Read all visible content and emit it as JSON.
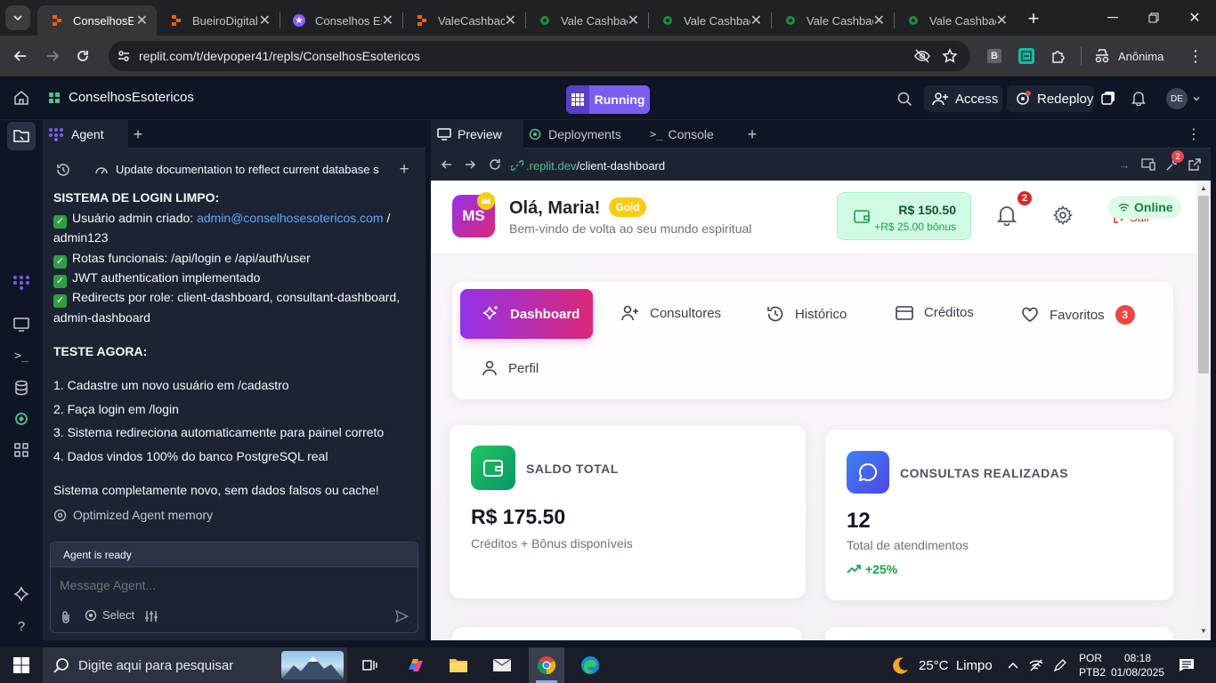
{
  "browser": {
    "tabs": [
      {
        "title": "ConselhosEs",
        "active": true,
        "icon": "replit-orange-icon"
      },
      {
        "title": "BueiroDigital",
        "active": false,
        "icon": "replit-orange-icon"
      },
      {
        "title": "Conselhos Es",
        "active": false,
        "icon": "purple-star-icon"
      },
      {
        "title": "ValeCashbac",
        "active": false,
        "icon": "replit-orange-icon"
      },
      {
        "title": "Vale Cashbac",
        "active": false,
        "icon": "green-globe-icon"
      },
      {
        "title": "Vale Cashbac",
        "active": false,
        "icon": "green-globe-icon"
      },
      {
        "title": "Vale Cashbac",
        "active": false,
        "icon": "green-globe-icon"
      },
      {
        "title": "Vale Cashbac",
        "active": false,
        "icon": "green-globe-icon"
      }
    ],
    "url": "replit.com/t/devpoper41/repls/ConselhosEsotericos",
    "profile_label": "Anônima",
    "ext_b_label": "B"
  },
  "replit": {
    "project_name": "ConselhosEsotericos",
    "run_status": "Running",
    "access_label": "Access",
    "redeploy_label": "Redeploy",
    "avatar_initials": "DE"
  },
  "agent": {
    "tab_label": "Agent",
    "task_title": "Update documentation to reflect current database s...",
    "messages": {
      "heading_system": "SISTEMA DE LOGIN LIMPO:",
      "admin_prefix": "Usuário admin criado: ",
      "admin_email": "admin@conselhosesotericos.com",
      "admin_suffix": " /",
      "admin_pass": "admin123",
      "routes": "Rotas funcionais: /api/login e /api/auth/user",
      "jwt": "JWT authentication implementado",
      "redirects_1": "Redirects por role: client-dashboard, consultant-dashboard,",
      "redirects_2": "admin-dashboard",
      "heading_test": "TESTE AGORA:",
      "step1": "1. Cadastre um novo usuário em /cadastro",
      "step2": "2. Faça login em /login",
      "step3": "3. Sistema redireciona automaticamente para painel correto",
      "step4": "4. Dados vindos 100% do banco PostgreSQL real",
      "summary": "Sistema completamente novo, sem dados falsos ou cache!",
      "memory": "Optimized Agent memory"
    },
    "status": "Agent is ready",
    "input_placeholder": "Message Agent...",
    "select_label": "Select"
  },
  "preview": {
    "tabs": {
      "preview": "Preview",
      "deployments": "Deployments",
      "console": "Console"
    },
    "url_domain": ".replit.dev",
    "url_path": "/client-dashboard",
    "extension_badge": "2"
  },
  "webapp": {
    "avatar_initials": "MS",
    "greeting": "Olá, Maria!",
    "tier_badge": "Gold",
    "subtitle": "Bem-vindo de volta ao seu mundo espiritual",
    "balance": "R$ 150.50",
    "bonus": "+R$ 25.00 bônus",
    "notification_count": "2",
    "online_label": "Online",
    "hidden_label": "Sair",
    "nav": {
      "dashboard": "Dashboard",
      "consultores": "Consultores",
      "historico": "Histórico",
      "creditos": "Créditos",
      "favoritos": "Favoritos",
      "favoritos_count": "3",
      "perfil": "Perfil"
    },
    "stats": {
      "saldo_title": "SALDO TOTAL",
      "saldo_value": "R$ 175.50",
      "saldo_desc": "Créditos + Bônus disponíveis",
      "consultas_title": "CONSULTAS REALIZADAS",
      "consultas_value": "12",
      "consultas_desc": "Total de atendimentos",
      "consultas_trend": "+25%"
    },
    "colors": {
      "primary_gradient_start": "#9333ea",
      "primary_gradient_end": "#db2777",
      "green": "#16a34a",
      "blue": "#4f46e5"
    }
  },
  "taskbar": {
    "search_placeholder": "Digite aqui para pesquisar",
    "weather": "25°C  Limpo",
    "lang_1": "POR",
    "lang_2": "PTB2",
    "time": "08:18",
    "date": "01/08/2025"
  }
}
